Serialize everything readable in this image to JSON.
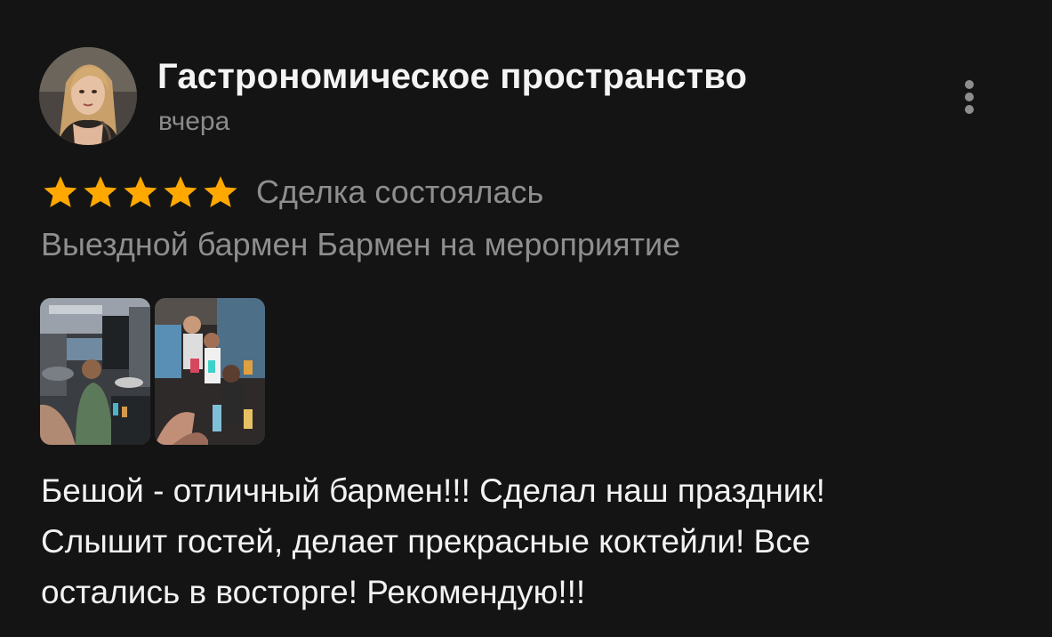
{
  "review": {
    "author_name": "Гастрономическое пространство",
    "date": "вчера",
    "rating": 5,
    "rating_max": 5,
    "deal_status": "Сделка состоялась",
    "service": "Выездной бармен Бармен на мероприятие",
    "text_lines": [
      "Бешой - отличный бармен!!! Сделал наш праздник!",
      "Слышит гостей, делает прекрасные коктейли! Все",
      "остались в восторге! Рекомендую!!!"
    ],
    "photo_count": 2
  },
  "icons": {
    "menu": "more-vertical-icon",
    "star": "star-icon"
  },
  "colors": {
    "background": "#141414",
    "text_primary": "#f2f2f2",
    "text_secondary": "#8e8e8e",
    "star": "#ffa800"
  }
}
